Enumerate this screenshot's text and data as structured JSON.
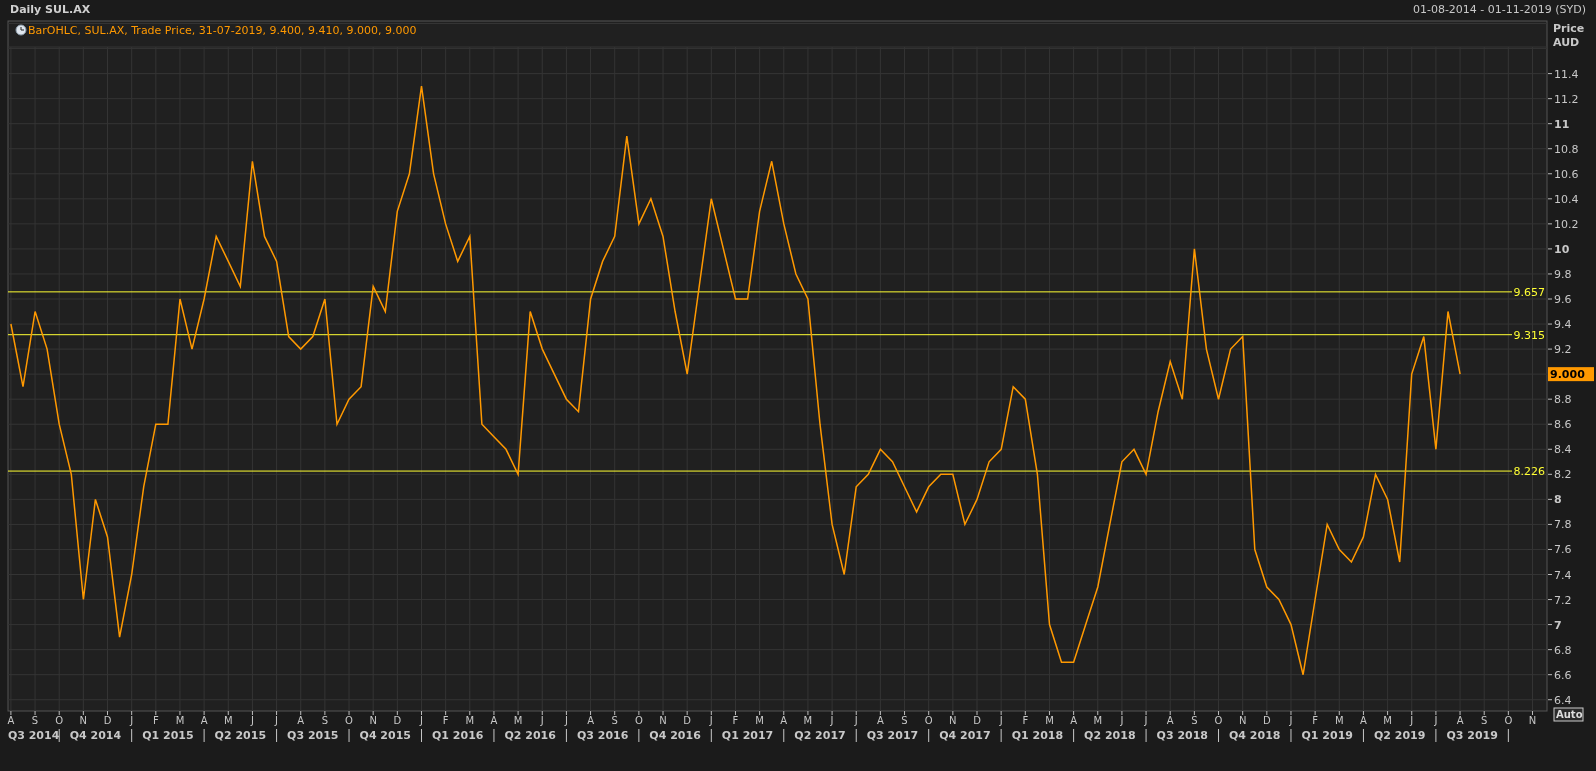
{
  "header": {
    "title": "Daily SUL.AX",
    "date_range": "01-08-2014 - 01-11-2019 (SYD)"
  },
  "chart": {
    "legend": "BarOHLC, SUL.AX, Trade Price, 31-07-2019, 9.400, 9.410, 9.000, 9.000",
    "last_price": "9.000",
    "auto_button": "Auto",
    "quarters": [
      "Q3 2014",
      "Q4 2014",
      "Q1 2015",
      "Q2 2015",
      "Q3 2015",
      "Q4 2015",
      "Q1 2016",
      "Q2 2016",
      "Q3 2016",
      "Q4 2016",
      "Q1 2017",
      "Q2 2017",
      "Q3 2017",
      "Q4 2017",
      "Q1 2018",
      "Q2 2018",
      "Q3 2018",
      "Q4 2018",
      "Q1 2019",
      "Q2 2019",
      "Q3 2019"
    ],
    "chart_data": {
      "type": "line",
      "ylabel": "Price AUD",
      "ylim": [
        6.31,
        11.82
      ],
      "categories": [
        "A",
        null,
        "S",
        null,
        "O",
        null,
        "N",
        null,
        "D",
        null,
        "J",
        null,
        "F",
        null,
        "M",
        null,
        "A",
        null,
        "M",
        null,
        "J",
        null,
        "J",
        null,
        "A",
        null,
        "S",
        null,
        "O",
        null,
        "N",
        null,
        "D",
        null,
        "J",
        null,
        "F",
        null,
        "M",
        null,
        "A",
        null,
        "M",
        null,
        "J",
        null,
        "J",
        null,
        "A",
        null,
        "S",
        null,
        "O",
        null,
        "N",
        null,
        "D",
        null,
        "J",
        null,
        "F",
        null,
        "M",
        null,
        "A",
        null,
        "M",
        null,
        "J",
        null,
        "J",
        null,
        "A",
        null,
        "S",
        null,
        "O",
        null,
        "N",
        null,
        "D",
        null,
        "J",
        null,
        "F",
        null,
        "M",
        null,
        "A",
        null,
        "M",
        null,
        "J",
        null,
        "J",
        null,
        "A",
        null,
        "S",
        null,
        "O",
        null,
        "N",
        null,
        "D",
        null,
        "J",
        null,
        "F",
        null,
        "M",
        null,
        "A",
        null,
        "M",
        null,
        "J",
        null,
        "J",
        null,
        "A",
        null,
        "S",
        null,
        "O",
        null,
        "N",
        null
      ],
      "series": [
        {
          "color": "#ff9900",
          "values": [
            9.4,
            8.9,
            9.5,
            9.2,
            8.6,
            8.2,
            7.2,
            8.0,
            7.7,
            6.9,
            7.4,
            8.1,
            8.6,
            8.6,
            9.6,
            9.2,
            9.6,
            10.1,
            9.9,
            9.7,
            10.7,
            10.1,
            9.9,
            9.3,
            9.2,
            9.3,
            9.6,
            8.6,
            8.8,
            8.9,
            9.7,
            9.5,
            10.3,
            10.6,
            11.3,
            10.6,
            10.2,
            9.9,
            10.1,
            8.6,
            8.5,
            8.4,
            8.2,
            9.5,
            9.2,
            9.0,
            8.8,
            8.7,
            9.6,
            9.9,
            10.1,
            10.9,
            10.2,
            10.4,
            10.1,
            9.5,
            9.0,
            9.7,
            10.4,
            10.0,
            9.6,
            9.6,
            10.3,
            10.7,
            10.2,
            9.8,
            9.6,
            8.6,
            7.8,
            7.4,
            8.1,
            8.2,
            8.4,
            8.3,
            8.1,
            7.9,
            8.1,
            8.2,
            8.2,
            7.8,
            8.0,
            8.3,
            8.4,
            8.9,
            8.8,
            8.2,
            7.0,
            6.7,
            6.7,
            7.0,
            7.3,
            7.8,
            8.3,
            8.4,
            8.2,
            8.7,
            9.1,
            8.8,
            10.0,
            9.2,
            8.8,
            9.2,
            9.3,
            7.6,
            7.3,
            7.2,
            7.0,
            6.6,
            7.2,
            7.8,
            7.6,
            7.5,
            7.7,
            8.2,
            8.0,
            7.5,
            9.0,
            9.3,
            8.4,
            9.5,
            9.0,
            null,
            null,
            null,
            null,
            null,
            null,
            null
          ]
        }
      ],
      "grid": true,
      "ref_lines": [
        {
          "axis": "y",
          "value": 9.657,
          "label": "9.657",
          "color": "#ffff33"
        },
        {
          "axis": "y",
          "value": 9.315,
          "label": "9.315",
          "color": "#ffff33"
        },
        {
          "axis": "y",
          "value": 8.226,
          "label": "8.226",
          "color": "#ffff33"
        }
      ],
      "yticks": [
        {
          "value": 6.4,
          "label": "6.4"
        },
        {
          "value": 6.6,
          "label": "6.6"
        },
        {
          "value": 6.8,
          "label": "6.8"
        },
        {
          "value": 7,
          "label": "7"
        },
        {
          "value": 7.2,
          "label": "7.2"
        },
        {
          "value": 7.4,
          "label": "7.4"
        },
        {
          "value": 7.6,
          "label": "7.6"
        },
        {
          "value": 7.8,
          "label": "7.8"
        },
        {
          "value": 8,
          "label": "8"
        },
        {
          "value": 8.2,
          "label": "8.2"
        },
        {
          "value": 8.4,
          "label": "8.4"
        },
        {
          "value": 8.6,
          "label": "8.6"
        },
        {
          "value": 8.8,
          "label": "8.8"
        },
        {
          "value": 9.2,
          "label": "9.2"
        },
        {
          "value": 9.4,
          "label": "9.4"
        },
        {
          "value": 9.6,
          "label": "9.6"
        },
        {
          "value": 9.8,
          "label": "9.8"
        },
        {
          "value": 10,
          "label": "10"
        },
        {
          "value": 10.2,
          "label": "10.2"
        },
        {
          "value": 10.4,
          "label": "10.4"
        },
        {
          "value": 10.6,
          "label": "10.6"
        },
        {
          "value": 10.8,
          "label": "10.8"
        },
        {
          "value": 11,
          "label": "11"
        },
        {
          "value": 11.2,
          "label": "11.2"
        },
        {
          "value": 11.4,
          "label": "11.4"
        }
      ]
    }
  }
}
